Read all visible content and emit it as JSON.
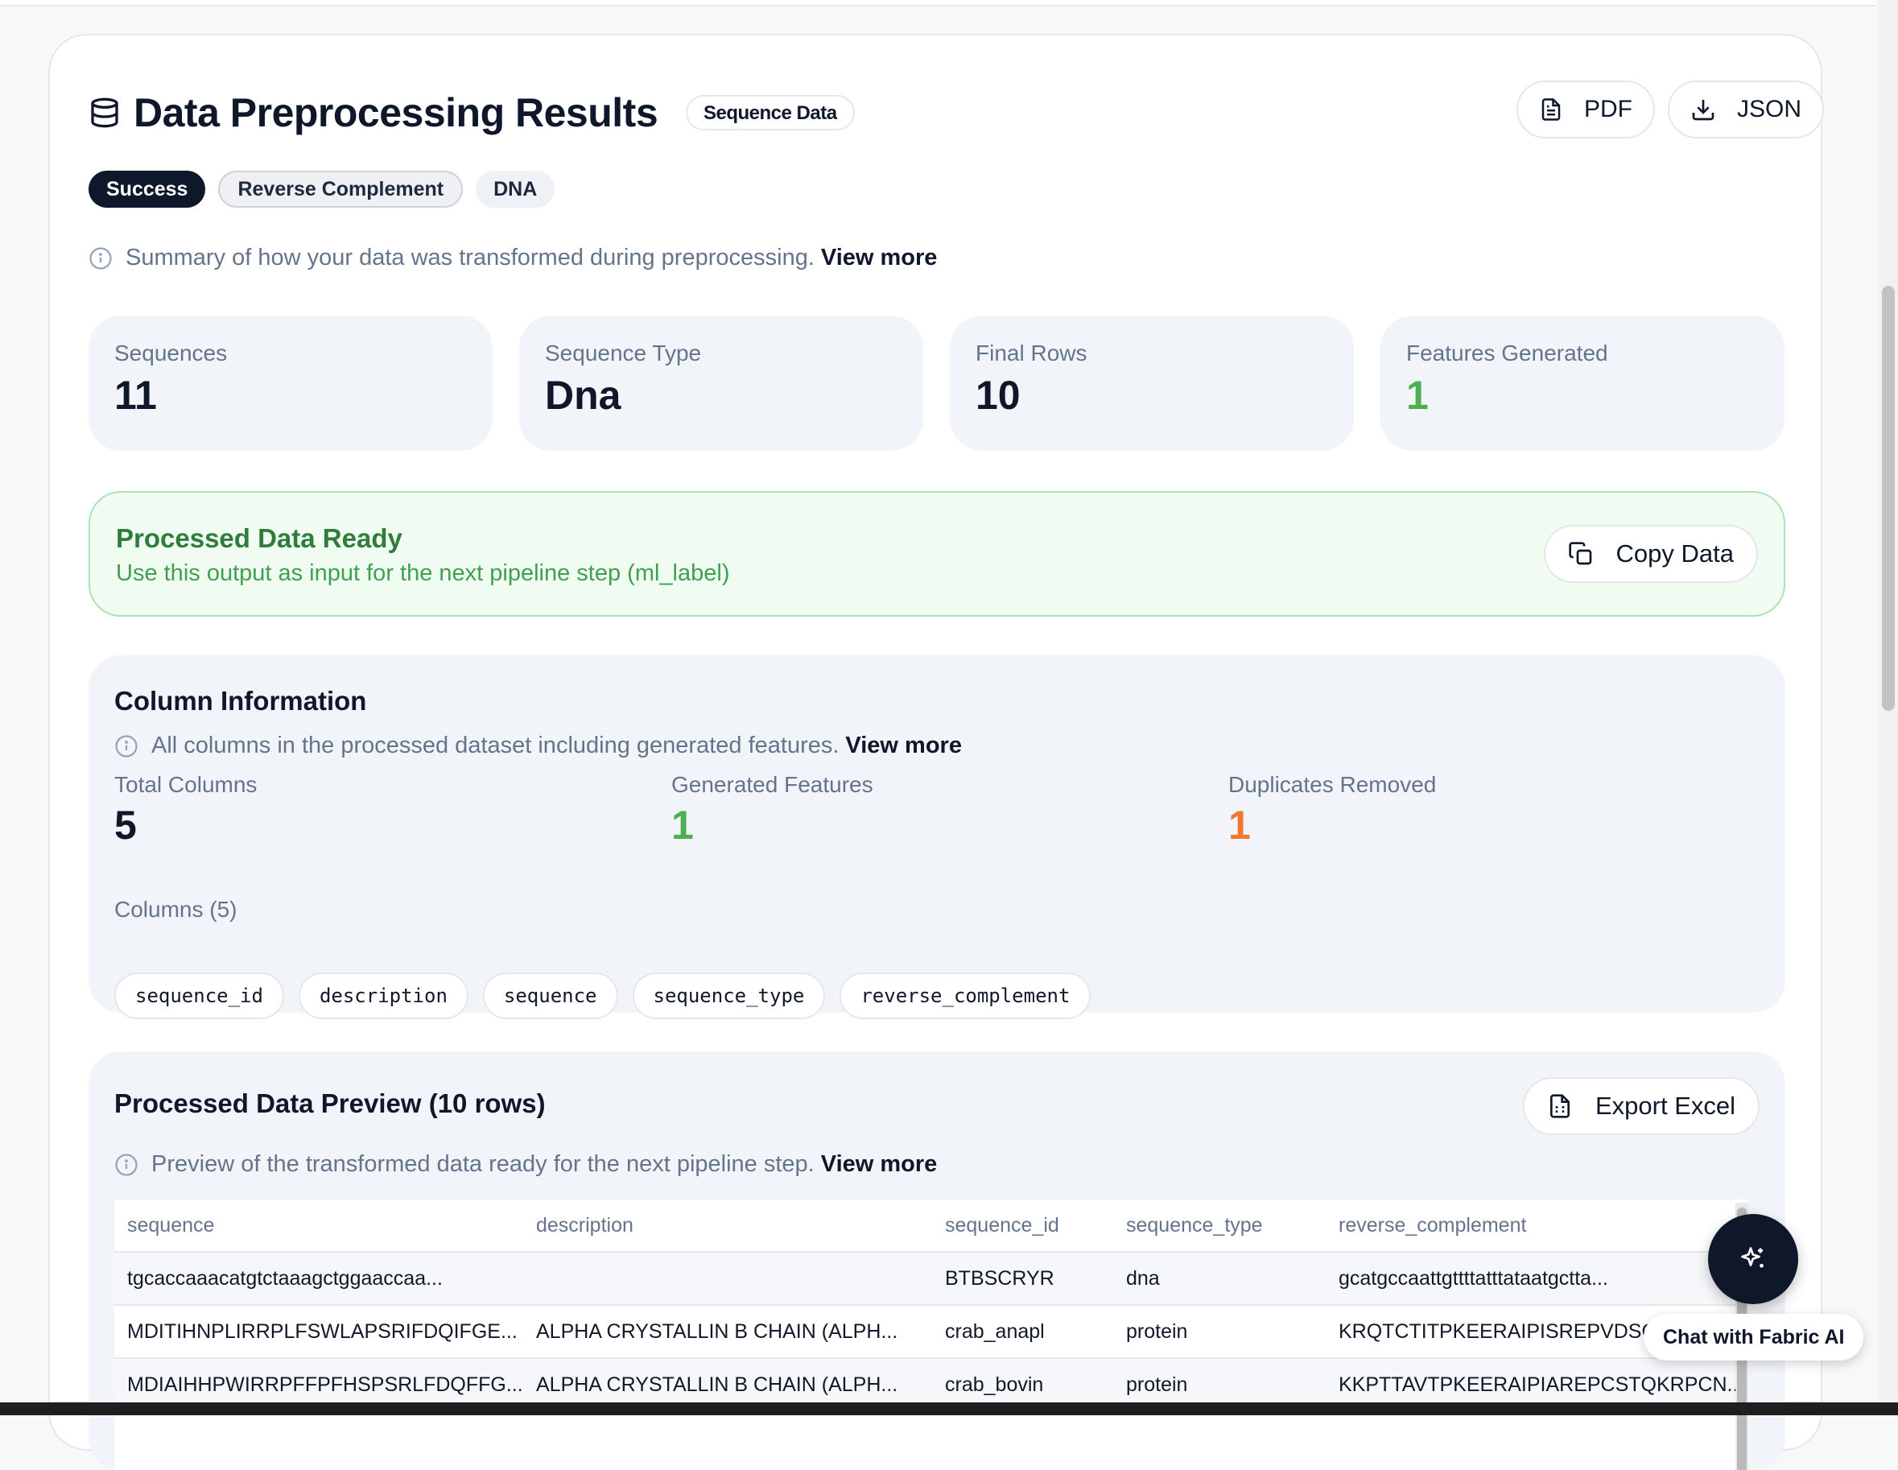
{
  "header": {
    "title": "Data Preprocessing Results",
    "badge": "Sequence Data",
    "pdf_label": "PDF",
    "json_label": "JSON"
  },
  "tags": [
    "Success",
    "Reverse Complement",
    "DNA"
  ],
  "summary": {
    "text": "Summary of how your data was transformed during preprocessing.",
    "more": "View more"
  },
  "stats": [
    {
      "label": "Sequences",
      "value": "11"
    },
    {
      "label": "Sequence Type",
      "value": "Dna"
    },
    {
      "label": "Final Rows",
      "value": "10"
    },
    {
      "label": "Features Generated",
      "value": "1"
    }
  ],
  "ready": {
    "title": "Processed Data Ready",
    "subtitle": "Use this output as input for the next pipeline step (ml_label)",
    "copy_label": "Copy Data"
  },
  "column_info": {
    "title": "Column Information",
    "info_text": "All columns in the processed dataset including generated features.",
    "more": "View more",
    "total_columns_label": "Total Columns",
    "total_columns": "5",
    "generated_label": "Generated Features",
    "generated": "1",
    "duplicates_label": "Duplicates Removed",
    "duplicates": "1",
    "columns_label": "Columns (5)",
    "columns": [
      "sequence_id",
      "description",
      "sequence",
      "sequence_type",
      "reverse_complement"
    ]
  },
  "preview": {
    "title": "Processed Data Preview (10 rows)",
    "export_label": "Export Excel",
    "info_text": "Preview of the transformed data ready for the next pipeline step.",
    "more": "View more",
    "headers": [
      "sequence",
      "description",
      "sequence_id",
      "sequence_type",
      "reverse_complement"
    ],
    "rows": [
      [
        "tgcaccaaacatgtctaaagctggaaccaa...",
        "",
        "BTBSCRYR",
        "dna",
        "gcatgccaattgttttatttataatgctta..."
      ],
      [
        "MDITIHNPLIRRPLFSWLAPSRIFDQIFGE...",
        "ALPHA CRYSTALLIN B CHAIN (ALPH...",
        "crab_anapl",
        "protein",
        "KRQTCTITPKEERAIPISREPVDSQK"
      ],
      [
        "MDIAIHHPWIRRPFFPFHSPSRLFDQFFG...",
        "ALPHA CRYSTALLIN B CHAIN (ALPH...",
        "crab_bovin",
        "protein",
        "KKPTTAVTPKEERAIPIAREPCSTQKRPCN..."
      ]
    ]
  },
  "chat": {
    "label": "Chat with Fabric AI"
  }
}
